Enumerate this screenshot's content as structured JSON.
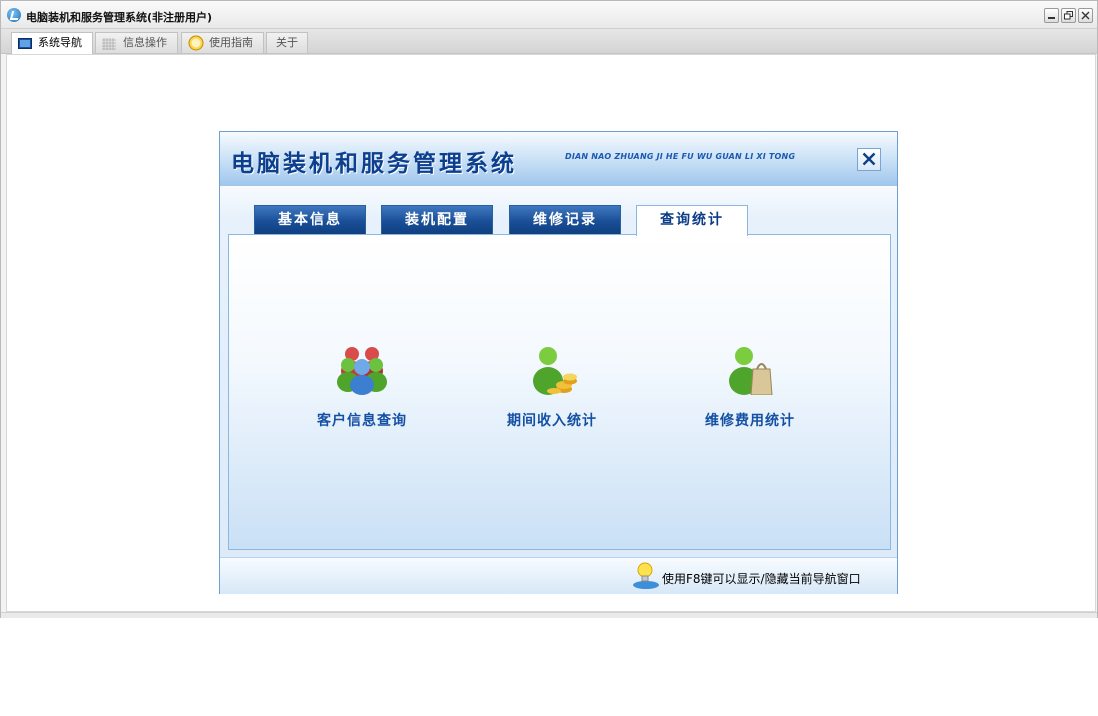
{
  "window": {
    "title": "电脑装机和服务管理系统(非注册用户)",
    "controls": [
      "minimize-icon",
      "restore-icon",
      "close-icon"
    ]
  },
  "tabs": [
    {
      "label": "系统导航",
      "icon": "monitor-icon",
      "active": true
    },
    {
      "label": "信息操作",
      "icon": "grid-icon",
      "active": false
    },
    {
      "label": "使用指南",
      "icon": "help-circle-icon",
      "active": false
    },
    {
      "label": "关于",
      "icon": "",
      "active": false
    }
  ],
  "nav": {
    "title": "电脑装机和服务管理系统",
    "pinyin": "DIAN NAO ZHUANG JI HE FU WU GUAN LI XI TONG",
    "tabs": [
      {
        "label": "基本信息",
        "active": false
      },
      {
        "label": "装机配置",
        "active": false
      },
      {
        "label": "维修记录",
        "active": false
      },
      {
        "label": "查询统计",
        "active": true
      }
    ],
    "functions": [
      {
        "label": "客户信息查询",
        "icon": "users-group-icon"
      },
      {
        "label": "期间收入统计",
        "icon": "user-coins-icon"
      },
      {
        "label": "维修费用统计",
        "icon": "user-bag-icon"
      }
    ],
    "tip": "使用F8键可以显示/隐藏当前导航窗口",
    "colors": {
      "header_blue": "#0c3f8e",
      "tab_blue": "#1a4f97",
      "label_blue": "#1450a3"
    }
  }
}
